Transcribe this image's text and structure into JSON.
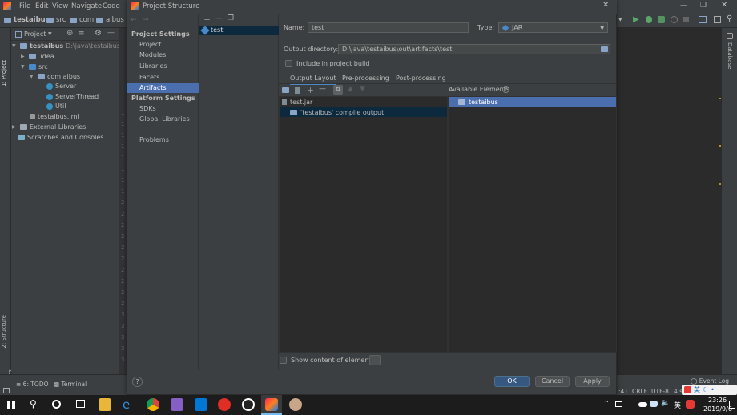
{
  "ide": {
    "menu": [
      "File",
      "Edit",
      "View",
      "Navigate",
      "Code"
    ],
    "breadcrumb": [
      "testaibus",
      "src",
      "com",
      "aibus"
    ],
    "project_header": "Project",
    "tree": [
      {
        "label": "testaibus",
        "extra": "D:\\java\\testaibus"
      },
      {
        "label": ".idea"
      },
      {
        "label": "src"
      },
      {
        "label": "com.aibus"
      },
      {
        "label": "Server"
      },
      {
        "label": "ServerThread"
      },
      {
        "label": "Util"
      },
      {
        "label": "testaibus.iml"
      },
      {
        "label": "External Libraries"
      },
      {
        "label": "Scratches and Consoles"
      }
    ],
    "left_tabs": [
      "1: Project",
      "2: Structure",
      "2: Favorites"
    ],
    "right_tab": "Database",
    "bottom": {
      "todo": "6: TODO",
      "terminal": "Terminal",
      "event_log": "Event Log",
      "status": [
        ":41",
        "CRLF",
        "UTF-8",
        "4 s"
      ]
    },
    "gutter_numbers": [
      "1",
      "1",
      "1",
      "1",
      "1",
      "1",
      "1",
      "1",
      "2",
      "2",
      "2",
      "2",
      "2",
      "2",
      "2",
      "2",
      "2",
      "2",
      "3",
      "3",
      "3",
      "3",
      "3"
    ]
  },
  "dialog": {
    "title": "Project Structure",
    "sections": {
      "project_settings": "Project Settings",
      "platform_settings": "Platform Settings"
    },
    "nav": {
      "project": "Project",
      "modules": "Modules",
      "libraries": "Libraries",
      "facets": "Facets",
      "artifacts": "Artifacts",
      "sdks": "SDKs",
      "global_libraries": "Global Libraries",
      "problems": "Problems"
    },
    "artifact": "test",
    "name_label": "Name:",
    "name_value": "test",
    "type_label": "Type:",
    "type_value": "JAR",
    "output_label": "Output directory:",
    "output_value": "D:\\java\\testaibus\\out\\artifacts\\test",
    "include_label": "Include in project build",
    "tabs": {
      "output_layout": "Output Layout",
      "pre_processing": "Pre-processing",
      "post_processing": "Post-processing"
    },
    "layout_items": {
      "jar": "test.jar",
      "compile_output": "'testaibus' compile output"
    },
    "available_label": "Available Elements",
    "available_items": [
      "testaibus"
    ],
    "show_content_label": "Show content of elements",
    "ellipsis": "...",
    "buttons": {
      "ok": "OK",
      "cancel": "Cancel",
      "apply": "Apply"
    },
    "help": "?"
  },
  "taskbar": {
    "time": "23:26",
    "date": "2019/9/6",
    "ime": "英"
  },
  "colors": {
    "selection": "#4b6eaf",
    "selection_dark": "#0d293e",
    "primary_button": "#365880",
    "dialog_bg": "#3c3f41"
  }
}
